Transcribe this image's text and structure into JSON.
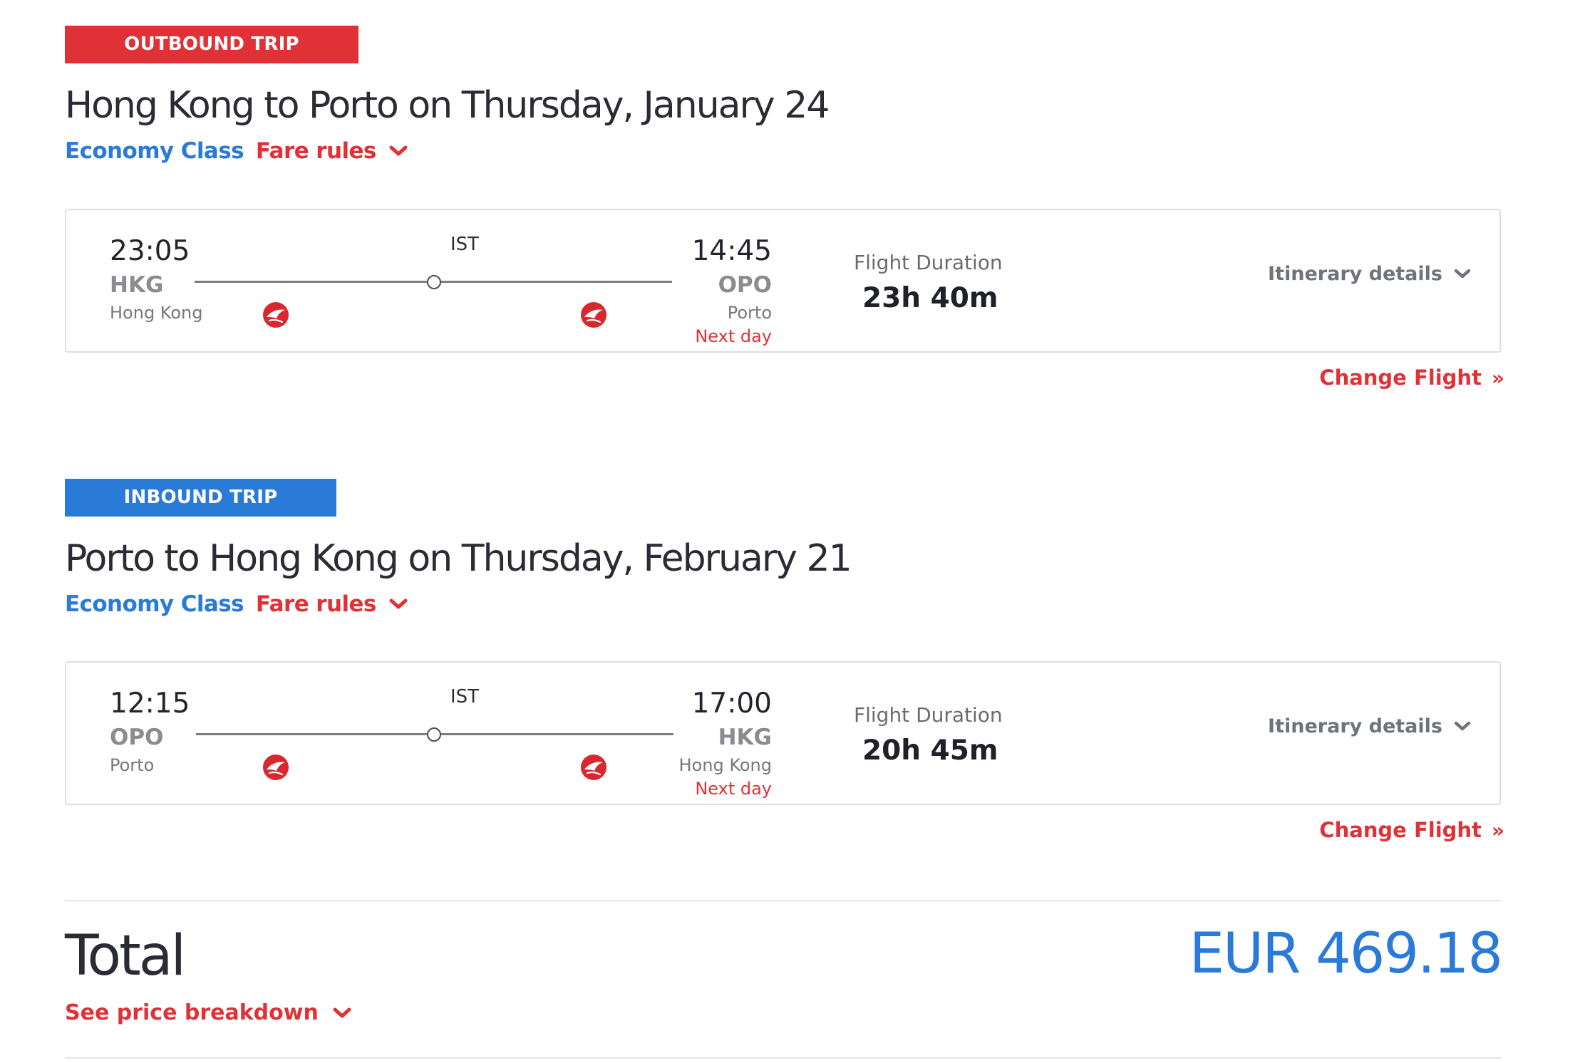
{
  "colors": {
    "outbound_accent": "#e03236",
    "inbound_accent": "#2a7ad8",
    "link_red": "#e03236",
    "price_blue": "#2a7ad8"
  },
  "outbound": {
    "badge": "OUTBOUND TRIP",
    "title": "Hong Kong to Porto on Thursday, January 24",
    "cabin_class": "Economy Class",
    "fare_rules": "Fare rules",
    "flight": {
      "departure_time": "23:05",
      "departure_code": "HKG",
      "departure_city": "Hong Kong",
      "stop_code": "IST",
      "arrival_time": "14:45",
      "arrival_code": "OPO",
      "arrival_city": "Porto",
      "arrival_note": "Next day",
      "duration_label": "Flight Duration",
      "duration": "23h 40m",
      "itinerary_link": "Itinerary details",
      "airline_logo_icon": "turkish-airlines-logo"
    },
    "change_flight": "Change Flight"
  },
  "inbound": {
    "badge": "INBOUND TRIP",
    "title": "Porto to Hong Kong on Thursday, February 21",
    "cabin_class": "Economy Class",
    "fare_rules": "Fare rules",
    "flight": {
      "departure_time": "12:15",
      "departure_code": "OPO",
      "departure_city": "Porto",
      "stop_code": "IST",
      "arrival_time": "17:00",
      "arrival_code": "HKG",
      "arrival_city": "Hong Kong",
      "arrival_note": "Next day",
      "duration_label": "Flight Duration",
      "duration": "20h 45m",
      "itinerary_link": "Itinerary details",
      "airline_logo_icon": "turkish-airlines-logo"
    },
    "change_flight": "Change Flight"
  },
  "total": {
    "label": "Total",
    "price": "EUR 469.18",
    "breakdown_link": "See price breakdown"
  }
}
